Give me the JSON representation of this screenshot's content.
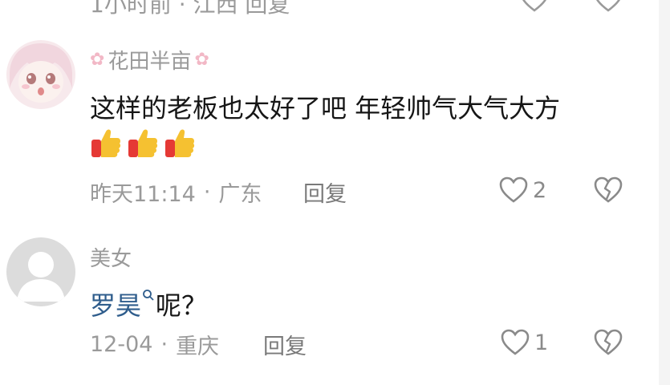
{
  "top_partial": {
    "meta_text": "1小时前 · 江西   回复"
  },
  "comments": [
    {
      "username": "花田半亩",
      "text": "这样的老板也太好了吧 年轻帅气大气大方",
      "emoji": [
        "thumbs-up-emoji",
        "thumbs-up-emoji",
        "thumbs-up-emoji"
      ],
      "time": "昨天11:14",
      "location": "广东",
      "separator": "·",
      "reply_label": "回复",
      "like_count": "2"
    },
    {
      "username": "美女",
      "mention": "罗昊",
      "text_after": "呢？",
      "time": "12-04",
      "location": "重庆",
      "separator": "·",
      "reply_label": "回复",
      "like_count": "1"
    }
  ],
  "colors": {
    "meta_gray": "#9a9a9a",
    "mention_blue": "#2f5d8c",
    "thumb_yellow": "#f5c131",
    "thumb_red": "#e53935"
  }
}
